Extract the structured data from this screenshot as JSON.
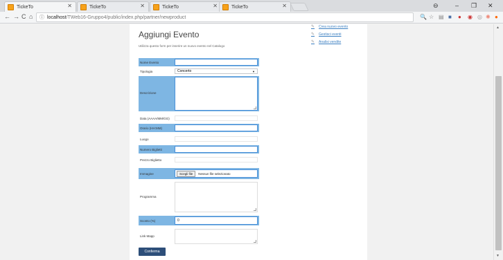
{
  "browser": {
    "tabs": [
      {
        "title": "TickeTo",
        "active": true
      },
      {
        "title": "TickeTo",
        "active": false
      },
      {
        "title": "TickeTo",
        "active": false
      },
      {
        "title": "TickeTo",
        "active": false
      }
    ],
    "url_host": "localhost",
    "url_path": "/TWeb16-Gruppo4/public/index.php/partner/newproduct"
  },
  "page": {
    "title": "Aggiungi Evento",
    "description": "Utilizza questo form per inserire un nuovo evento nel Catalogo"
  },
  "side_links": [
    {
      "label": "Crea nuovo evento"
    },
    {
      "label": "Gestisci eventi"
    },
    {
      "label": "Analisi vendite"
    }
  ],
  "form": {
    "name_label": "Nome Evento",
    "type_label": "Tipologia",
    "type_value": "Concerto",
    "description_label": "Descrizione",
    "date_label": "Data (AAAA/MM/GG)",
    "time_label": "Orario (HH:MM)",
    "place_label": "Luogo",
    "tickets_label": "Numero Biglietti",
    "price_label": "Prezzo Biglietto",
    "image_label": "Immagine",
    "file_button": "Scegli file",
    "file_status": "Nessun file selezionato",
    "program_label": "Programma",
    "discount_label": "Sconto (%)",
    "discount_value": "0",
    "map_label": "Link Mapp",
    "submit_label": "Conferma"
  },
  "colors": {
    "highlight": "#7eb6e3",
    "submit": "#2d4e79",
    "link": "#3a7fc1"
  }
}
